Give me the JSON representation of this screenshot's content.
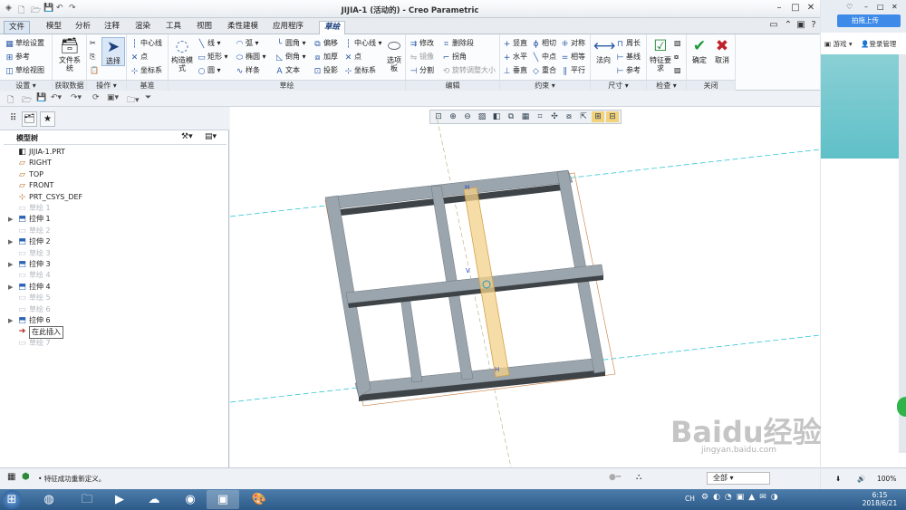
{
  "window": {
    "title": "JIJIA-1 (活动的) - Creo Parametric"
  },
  "menu_tabs": [
    "文件",
    "模型",
    "分析",
    "注释",
    "渲染",
    "工具",
    "视图",
    "柔性建模",
    "应用程序",
    "草绘"
  ],
  "active_tab": "草绘",
  "ribbon": {
    "setup": {
      "label": "设置",
      "items": [
        "草绘设置",
        "参考",
        "草绘视图"
      ]
    },
    "data": {
      "label": "获取数据",
      "file_system": "文件系统"
    },
    "ops": {
      "label": "操作",
      "select": "选择"
    },
    "datum": {
      "label": "基准",
      "items": [
        "中心线",
        "点",
        "坐标系"
      ]
    },
    "sketch": {
      "label": "草绘",
      "construction": "构造模式",
      "col1": [
        "线",
        "矩形",
        "圆"
      ],
      "col2": [
        "弧",
        "椭圆",
        "样条"
      ],
      "col3": [
        "圆角",
        "倒角",
        "文本"
      ],
      "col4": [
        "偏移",
        "加厚",
        "投影"
      ],
      "col5": [
        "中心线",
        "点",
        "坐标系"
      ],
      "palette": "选项板"
    },
    "edit": {
      "label": "编辑",
      "items": [
        "修改",
        "删除段",
        "镜像",
        "拐角",
        "分割",
        "旋转调整大小"
      ]
    },
    "constrain": {
      "label": "约束",
      "items": [
        "竖直",
        "相切",
        "对称",
        "水平",
        "中点",
        "相等",
        "垂直",
        "重合",
        "平行"
      ]
    },
    "dimension": {
      "label": "尺寸",
      "normal": "法向",
      "items": [
        "周长",
        "基线",
        "参考"
      ]
    },
    "inspect": {
      "label": "检查",
      "feature_req": "特征要求"
    },
    "close": {
      "label": "关闭",
      "ok": "确定",
      "cancel": "取消"
    }
  },
  "model_tree": {
    "title": "模型树",
    "nodes": [
      {
        "label": "JIJIA-1.PRT",
        "icon": "part-icon",
        "dim": false,
        "expand": false
      },
      {
        "label": "RIGHT",
        "icon": "datum-plane-icon",
        "dim": false,
        "expand": false
      },
      {
        "label": "TOP",
        "icon": "datum-plane-icon",
        "dim": false,
        "expand": false
      },
      {
        "label": "FRONT",
        "icon": "datum-plane-icon",
        "dim": false,
        "expand": false
      },
      {
        "label": "PRT_CSYS_DEF",
        "icon": "csys-icon",
        "dim": false,
        "expand": false
      },
      {
        "label": "草绘 1",
        "icon": "sketch-icon",
        "dim": true,
        "expand": false
      },
      {
        "label": "拉伸 1",
        "icon": "extrude-icon",
        "dim": false,
        "expand": true
      },
      {
        "label": "草绘 2",
        "icon": "sketch-icon",
        "dim": true,
        "expand": false
      },
      {
        "label": "拉伸 2",
        "icon": "extrude-icon",
        "dim": false,
        "expand": true
      },
      {
        "label": "草绘 3",
        "icon": "sketch-icon",
        "dim": true,
        "expand": false
      },
      {
        "label": "拉伸 3",
        "icon": "extrude-icon",
        "dim": false,
        "expand": true
      },
      {
        "label": "草绘 4",
        "icon": "sketch-icon",
        "dim": true,
        "expand": false
      },
      {
        "label": "拉伸 4",
        "icon": "extrude-icon",
        "dim": false,
        "expand": true
      },
      {
        "label": "草绘 5",
        "icon": "sketch-icon",
        "dim": true,
        "expand": false
      },
      {
        "label": "草绘 6",
        "icon": "sketch-icon",
        "dim": true,
        "expand": false
      },
      {
        "label": "拉伸 6",
        "icon": "extrude-icon",
        "dim": false,
        "expand": true
      },
      {
        "label": "在此插入",
        "icon": "insert-arrow-icon",
        "dim": false,
        "expand": false
      },
      {
        "label": "草绘 7",
        "icon": "sketch-icon",
        "dim": true,
        "expand": false
      }
    ]
  },
  "status": {
    "message": "特征成功重新定义。",
    "filter": "全部"
  },
  "browser": {
    "upload": "拍拖上传",
    "links": [
      "游戏",
      "登录管理"
    ],
    "zoom": "100%"
  },
  "taskbar": {
    "lang": "CH",
    "time": "6:15",
    "date": "2018/6/21"
  },
  "watermark": {
    "text": "Baidu经验",
    "url": "jingyan.baidu.com"
  },
  "colors": {
    "frame": "#9ba5ad",
    "frame_dark": "#3d4347",
    "highlight": "#f3d18a",
    "axis": "#33c6d6",
    "ribbon_bg": "#fbfcfd"
  }
}
